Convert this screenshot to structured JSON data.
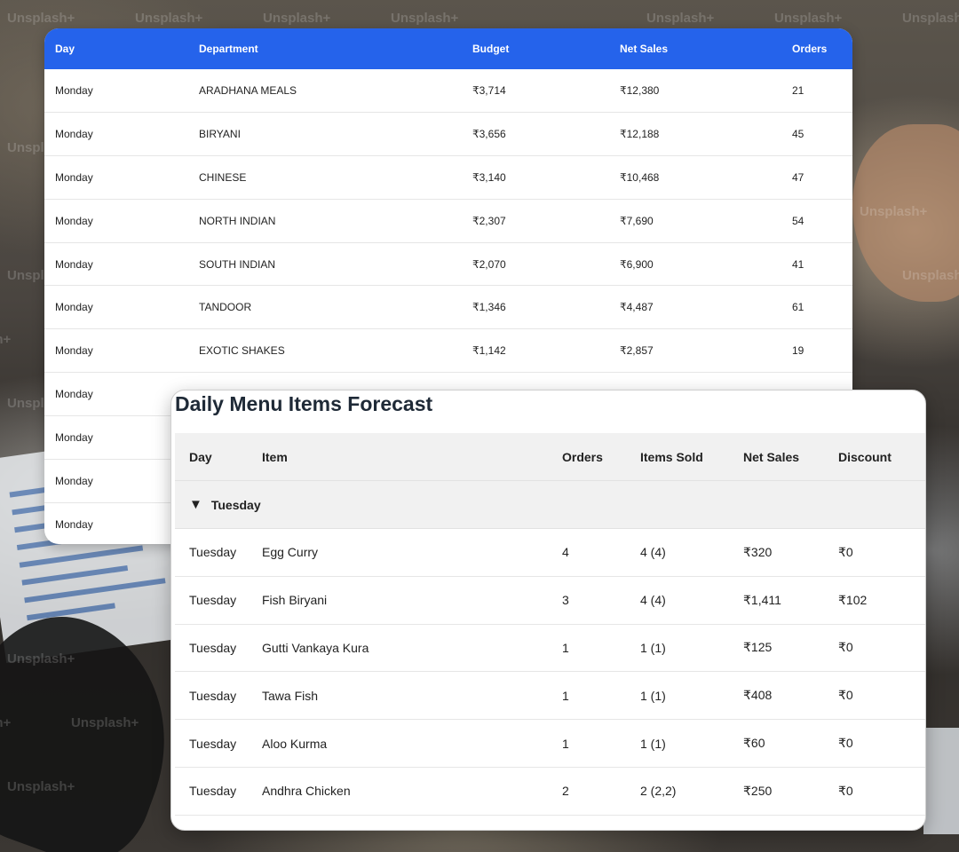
{
  "watermark": {
    "text": "Unsplash+"
  },
  "department_table": {
    "columns": {
      "day": "Day",
      "department": "Department",
      "budget": "Budget",
      "net_sales": "Net Sales",
      "orders": "Orders"
    },
    "rows": [
      {
        "day": "Monday",
        "department": "ARADHANA MEALS",
        "budget": "₹3,714",
        "net_sales": "₹12,380",
        "orders": "21"
      },
      {
        "day": "Monday",
        "department": "BIRYANI",
        "budget": "₹3,656",
        "net_sales": "₹12,188",
        "orders": "45"
      },
      {
        "day": "Monday",
        "department": "CHINESE",
        "budget": "₹3,140",
        "net_sales": "₹10,468",
        "orders": "47"
      },
      {
        "day": "Monday",
        "department": "NORTH INDIAN",
        "budget": "₹2,307",
        "net_sales": "₹7,690",
        "orders": "54"
      },
      {
        "day": "Monday",
        "department": "SOUTH INDIAN",
        "budget": "₹2,070",
        "net_sales": "₹6,900",
        "orders": "41"
      },
      {
        "day": "Monday",
        "department": "TANDOOR",
        "budget": "₹1,346",
        "net_sales": "₹4,487",
        "orders": "61"
      },
      {
        "day": "Monday",
        "department": "EXOTIC SHAKES",
        "budget": "₹1,142",
        "net_sales": "₹2,857",
        "orders": "19"
      },
      {
        "day": "Monday",
        "department": "",
        "budget": "",
        "net_sales": "",
        "orders": ""
      },
      {
        "day": "Monday",
        "department": "",
        "budget": "",
        "net_sales": "",
        "orders": ""
      },
      {
        "day": "Monday",
        "department": "",
        "budget": "",
        "net_sales": "",
        "orders": ""
      },
      {
        "day": "Monday",
        "department": "",
        "budget": "",
        "net_sales": "",
        "orders": ""
      }
    ]
  },
  "forecast": {
    "title": "Daily Menu Items Forecast",
    "columns": {
      "day": "Day",
      "item": "Item",
      "orders": "Orders",
      "items_sold": "Items Sold",
      "net_sales": "Net Sales",
      "discount": "Discount"
    },
    "group": {
      "toggle_icon": "▼",
      "label": "Tuesday"
    },
    "rows": [
      {
        "day": "Tuesday",
        "item": "Egg Curry",
        "orders": "4",
        "items_sold": "4 (4)",
        "net_sales": "₹320",
        "discount": "₹0"
      },
      {
        "day": "Tuesday",
        "item": "Fish Biryani",
        "orders": "3",
        "items_sold": "4 (4)",
        "net_sales": "₹1,411",
        "discount": "₹102"
      },
      {
        "day": "Tuesday",
        "item": "Gutti Vankaya Kura",
        "orders": "1",
        "items_sold": "1 (1)",
        "net_sales": "₹125",
        "discount": "₹0"
      },
      {
        "day": "Tuesday",
        "item": "Tawa Fish",
        "orders": "1",
        "items_sold": "1 (1)",
        "net_sales": "₹408",
        "discount": "₹0"
      },
      {
        "day": "Tuesday",
        "item": "Aloo Kurma",
        "orders": "1",
        "items_sold": "1 (1)",
        "net_sales": "₹60",
        "discount": "₹0"
      },
      {
        "day": "Tuesday",
        "item": "Andhra Chicken",
        "orders": "2",
        "items_sold": "2 (2,2)",
        "net_sales": "₹250",
        "discount": "₹0"
      }
    ]
  },
  "colors": {
    "header_blue": "#2563eb",
    "header_gray": "#f1f1f1",
    "title_text": "#1f2a37"
  }
}
